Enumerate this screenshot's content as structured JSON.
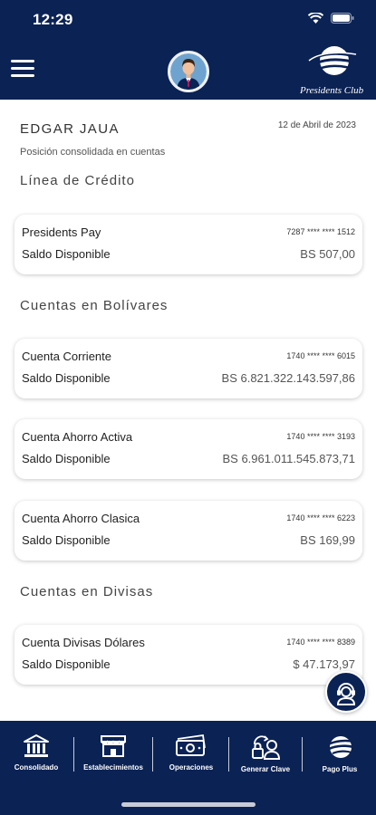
{
  "status_bar": {
    "time": "12:29"
  },
  "header": {
    "logo_text": "Presidents Club"
  },
  "user": {
    "name": "EDGAR JAUA",
    "date": "12 de Abril de 2023",
    "subtitle": "Posición consolidada en cuentas"
  },
  "sections": {
    "credit": "Línea de Crédito",
    "bolivares": "Cuentas en Bolívares",
    "divisas": "Cuentas en Divisas"
  },
  "accounts": [
    {
      "name": "Presidents Pay",
      "number": "7287 **** **** 1512",
      "label": "Saldo Disponible",
      "balance": "BS 507,00"
    },
    {
      "name": "Cuenta Corriente",
      "number": "1740 **** **** 6015",
      "label": "Saldo Disponible",
      "balance": "BS 6.821.322.143.597,86"
    },
    {
      "name": "Cuenta Ahorro Activa",
      "number": "1740 **** **** 3193",
      "label": "Saldo Disponible",
      "balance": "BS 6.961.011.545.873,71"
    },
    {
      "name": "Cuenta Ahorro Clasica",
      "number": "1740 **** **** 6223",
      "label": "Saldo Disponible",
      "balance": "BS 169,99"
    },
    {
      "name": "Cuenta Divisas Dólares",
      "number": "1740 **** **** 8389",
      "label": "Saldo Disponible",
      "balance": "$ 47.173,97"
    }
  ],
  "nav": {
    "consolidado": "Consolidado",
    "establecimientos": "Establecimientos",
    "operaciones": "Operaciones",
    "generar_clave": "Generar Clave",
    "pago_plus": "Pago Plus"
  },
  "colors": {
    "primary": "#0b2254",
    "background": "#ffffff"
  },
  "icons": [
    "menu-icon",
    "bank-icon",
    "store-icon",
    "cash-icon",
    "key-user-icon",
    "pago-plus-icon",
    "support-agent-icon"
  ]
}
